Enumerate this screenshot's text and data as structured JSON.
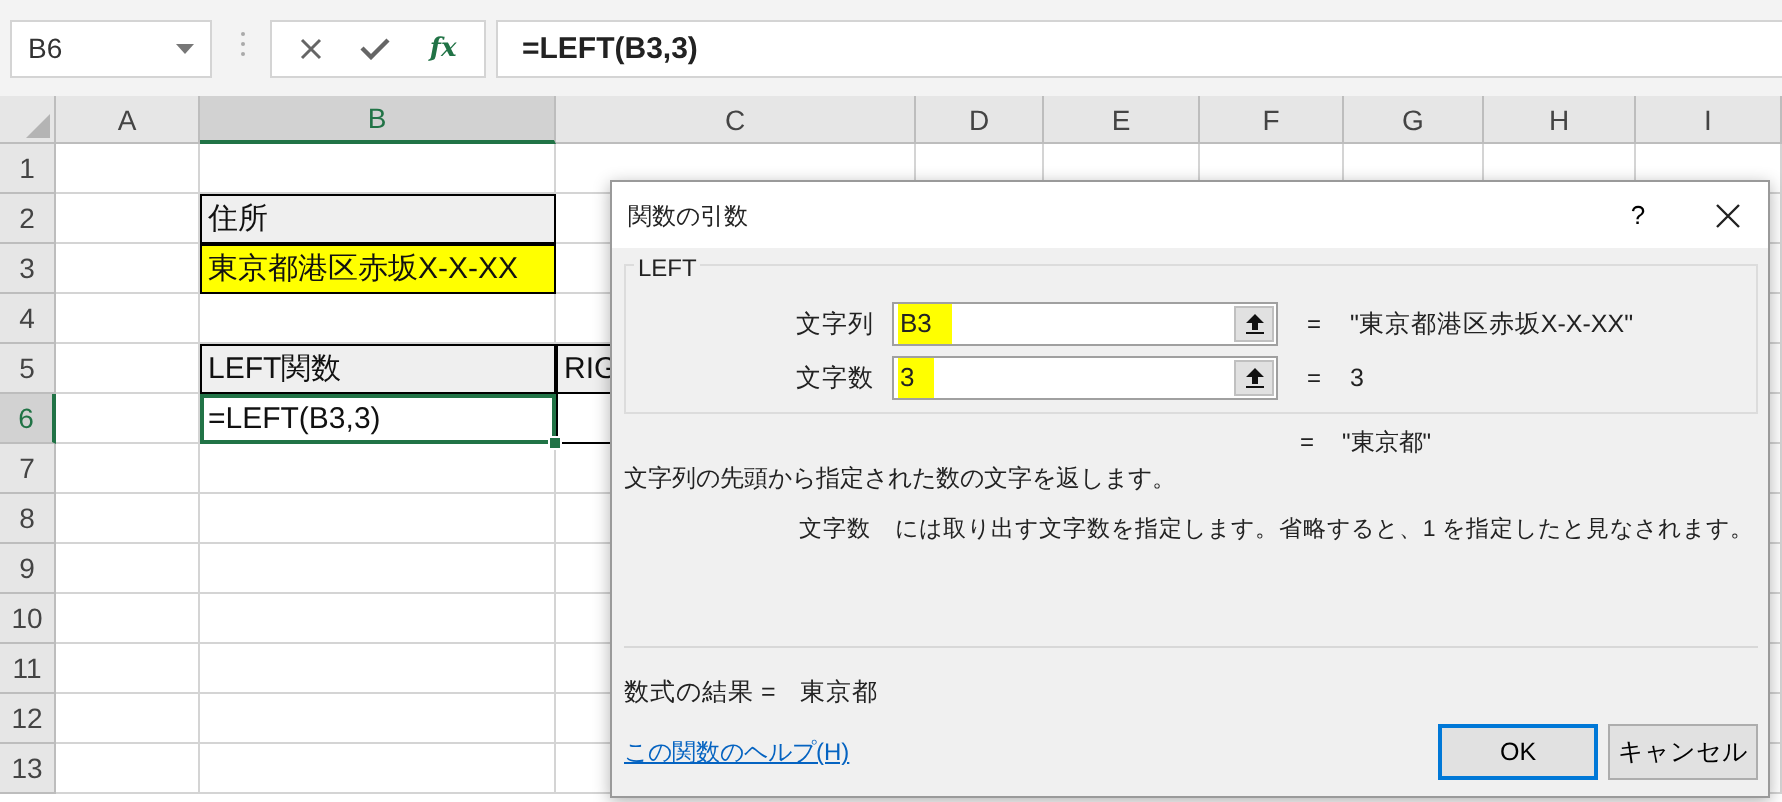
{
  "formula_bar": {
    "name_box": "B6",
    "function_label": "fx",
    "formula": "=LEFT(B3,3)"
  },
  "sheet": {
    "columns": [
      {
        "label": "A",
        "selected": false
      },
      {
        "label": "B",
        "selected": true
      },
      {
        "label": "C",
        "selected": false
      },
      {
        "label": "D",
        "selected": false
      },
      {
        "label": "E",
        "selected": false
      },
      {
        "label": "F",
        "selected": false
      },
      {
        "label": "G",
        "selected": false
      },
      {
        "label": "H",
        "selected": false
      },
      {
        "label": "I",
        "selected": false
      }
    ],
    "rows": [
      {
        "label": "1",
        "selected": false,
        "cells": []
      },
      {
        "label": "2",
        "selected": false,
        "cells": [
          {
            "kind": "empty"
          },
          {
            "text": "住所",
            "kind": "header"
          }
        ]
      },
      {
        "label": "3",
        "selected": false,
        "cells": [
          {
            "kind": "empty"
          },
          {
            "text": "東京都港区赤坂X-X-XX",
            "kind": "highlight"
          }
        ]
      },
      {
        "label": "4",
        "selected": false,
        "cells": []
      },
      {
        "label": "5",
        "selected": false,
        "cells": [
          {
            "kind": "empty"
          },
          {
            "text": "LEFT関数",
            "kind": "header"
          },
          {
            "text": "RIG",
            "kind": "header"
          }
        ]
      },
      {
        "label": "6",
        "selected": true,
        "cells": [
          {
            "kind": "empty"
          },
          {
            "text": "=LEFT(B3,3)",
            "kind": "plain",
            "selected": true
          },
          {
            "kind": "plain",
            "selected": false
          }
        ]
      },
      {
        "label": "7",
        "selected": false,
        "cells": []
      },
      {
        "label": "8",
        "selected": false,
        "cells": []
      },
      {
        "label": "9",
        "selected": false,
        "cells": []
      },
      {
        "label": "10",
        "selected": false,
        "cells": []
      },
      {
        "label": "11",
        "selected": false,
        "cells": []
      },
      {
        "label": "12",
        "selected": false,
        "cells": []
      },
      {
        "label": "13",
        "selected": false,
        "cells": []
      }
    ]
  },
  "dialog": {
    "title": "関数の引数",
    "help_button": "?",
    "function_name": "LEFT",
    "arguments": [
      {
        "label": "文字列",
        "value": "B3",
        "equals": "=",
        "result": "\"東京都港区赤坂X-X-XX\""
      },
      {
        "label": "文字数",
        "value": "3",
        "equals": "=",
        "result": "3"
      }
    ],
    "function_result": {
      "equals": "=",
      "value": "\"東京都\""
    },
    "description": "文字列の先頭から指定された数の文字を返します。",
    "argument_help": {
      "name": "文字数",
      "text": "には取り出す文字数を指定します。省略すると、1 を指定したと見なされます。"
    },
    "formula_result": {
      "label": "数式の結果 =",
      "value": "東京都"
    },
    "help_link": "この関数のヘルプ(H)",
    "buttons": [
      {
        "label": "OK",
        "default": true
      },
      {
        "label": "キャンセル",
        "default": false
      }
    ]
  }
}
